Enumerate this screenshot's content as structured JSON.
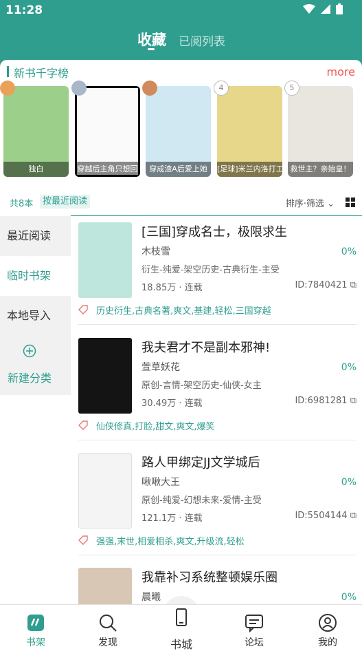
{
  "status": {
    "time": "11:28"
  },
  "tabs": {
    "active": "收藏",
    "inactive": "已阅列表"
  },
  "ranking": {
    "title": "新书千字榜",
    "more": "more",
    "books": [
      {
        "rank": "1",
        "title": "独白",
        "color": "#9ccf8a"
      },
      {
        "rank": "2",
        "title": "穿越后主角只想回",
        "color": "#fafafa"
      },
      {
        "rank": "3",
        "title": "穿成渣A后爱上她",
        "color": "#cfe8f2"
      },
      {
        "rank": "4",
        "title": "[足球]米兰内洛打工",
        "color": "#e7d78a"
      },
      {
        "rank": "5",
        "title": "救世主？亲始皇！",
        "color": "#e9e6df"
      }
    ]
  },
  "filter": {
    "count": "共8本",
    "sort": "按最近阅读",
    "sort_filter": "排序·筛选"
  },
  "sidebar": {
    "items": [
      {
        "label": "最近阅读"
      },
      {
        "label": "临时书架"
      },
      {
        "label": "本地导入"
      }
    ],
    "new_category": "新建分类"
  },
  "books": [
    {
      "title": "[三国]穿成名士，极限求生",
      "author": "木枝雪",
      "progress": "0%",
      "genre": "衍生-纯爱-架空历史-古典衍生-主受",
      "size": "18.85万 · 连载",
      "id": "ID:7840421",
      "tags": "历史衍生,古典名著,爽文,基建,轻松,三国穿越",
      "cover_color": "#bfe6dc"
    },
    {
      "title": "我夫君才不是副本邪神!",
      "author": "萱草妖花",
      "progress": "0%",
      "genre": "原创-言情-架空历史-仙侠-女主",
      "size": "30.49万 · 连载",
      "id": "ID:6981281",
      "tags": "仙侠修真,打脸,甜文,爽文,爆笑",
      "cover_color": "#141414"
    },
    {
      "title": "路人甲绑定JJ文学城后",
      "author": "啾啾大王",
      "progress": "0%",
      "genre": "原创-纯爱-幻想未来-爱情-主受",
      "size": "121.1万 · 连载",
      "id": "ID:5504144",
      "tags": "强强,末世,相爱相杀,爽文,升级流,轻松",
      "cover_color": "#f4f4f4"
    },
    {
      "title": "我靠补习系统整顿娱乐圈",
      "author": "晨曦",
      "progress": "0%",
      "cover_color": "#d8c7b5"
    }
  ],
  "nav": [
    {
      "label": "书架"
    },
    {
      "label": "发现"
    },
    {
      "label": "书城"
    },
    {
      "label": "论坛"
    },
    {
      "label": "我的"
    }
  ],
  "colors": {
    "accent": "#2f9e8f",
    "more": "#ee5555"
  }
}
